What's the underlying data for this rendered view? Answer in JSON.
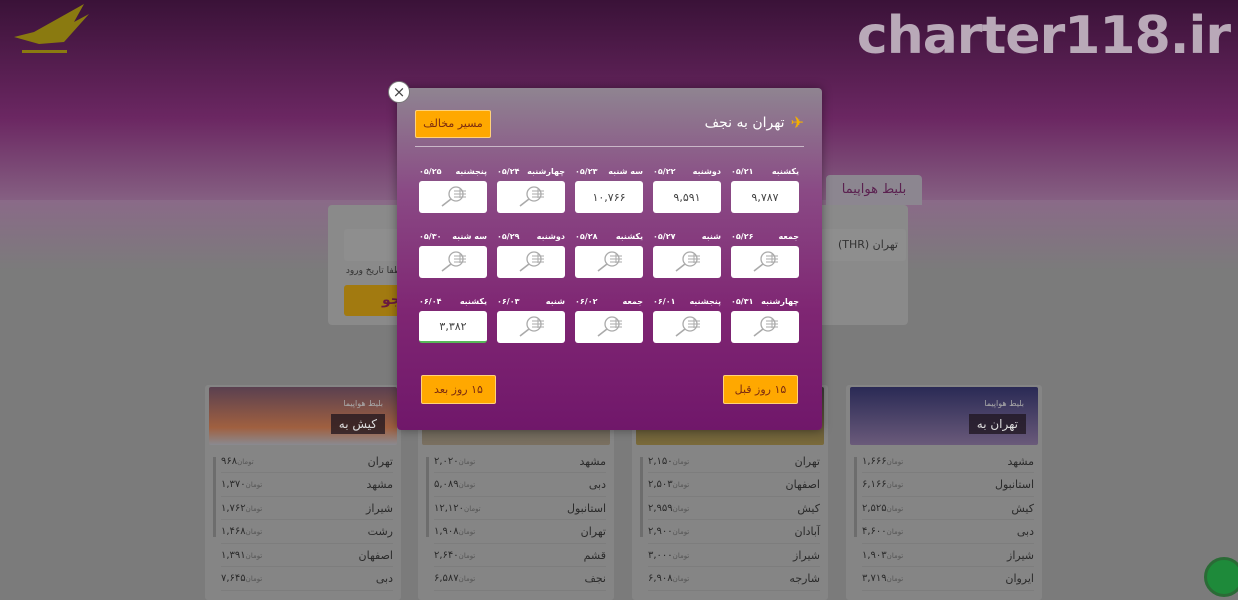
{
  "site": {
    "brand": "charter118.ir",
    "logo_text": "logo"
  },
  "search": {
    "tab_label": "بلیط هواپیما",
    "origin_value": "تهران (THR)",
    "date_hint": "لطفا تاریخ ورود را وارد نمایید",
    "search_button": "جستجو"
  },
  "modal": {
    "title": "تهران به نجف",
    "opposite_route_button": "مسیر مخالف",
    "prev_button": "۱۵ روز قبل",
    "next_button": "۱۵ روز بعد",
    "close_label": "×",
    "days": [
      {
        "weekday": "یکشنبه",
        "date": "۰۵/۲۱",
        "price": "۹,۷۸۷"
      },
      {
        "weekday": "دوشنبه",
        "date": "۰۵/۲۲",
        "price": "۹,۵۹۱"
      },
      {
        "weekday": "سه شنبه",
        "date": "۰۵/۲۳",
        "price": "۱۰,۷۶۶"
      },
      {
        "weekday": "چهارشنبه",
        "date": "۰۵/۲۴",
        "price": null
      },
      {
        "weekday": "پنجشنبه",
        "date": "۰۵/۲۵",
        "price": null
      },
      {
        "weekday": "جمعه",
        "date": "۰۵/۲۶",
        "price": null
      },
      {
        "weekday": "شنبه",
        "date": "۰۵/۲۷",
        "price": null
      },
      {
        "weekday": "یکشنبه",
        "date": "۰۵/۲۸",
        "price": null
      },
      {
        "weekday": "دوشنبه",
        "date": "۰۵/۲۹",
        "price": null
      },
      {
        "weekday": "سه شنبه",
        "date": "۰۵/۳۰",
        "price": null
      },
      {
        "weekday": "چهارشنبه",
        "date": "۰۵/۳۱",
        "price": null
      },
      {
        "weekday": "پنجشنبه",
        "date": "۰۶/۰۱",
        "price": null
      },
      {
        "weekday": "جمعه",
        "date": "۰۶/۰۲",
        "price": null
      },
      {
        "weekday": "شنبه",
        "date": "۰۶/۰۳",
        "price": null
      },
      {
        "weekday": "یکشنبه",
        "date": "۰۶/۰۴",
        "price": "۳,۳۸۲",
        "selected": true
      }
    ]
  },
  "cards": [
    {
      "subtitle": "بلیط هواپیما",
      "title": "تهران به",
      "rows": [
        [
          "مشهد",
          "۱,۶۶۶"
        ],
        [
          "استانبول",
          "۶,۱۶۶"
        ],
        [
          "کیش",
          "۲,۵۲۵"
        ],
        [
          "دبی",
          "۴,۶۰۰"
        ],
        [
          "شیراز",
          "۱,۹۰۳"
        ],
        [
          "ایروان",
          "۳,۷۱۹"
        ]
      ]
    },
    {
      "subtitle": "",
      "title": "",
      "rows": [
        [
          "تهران",
          "۲,۱۵۰"
        ],
        [
          "اصفهان",
          "۲,۵۰۳"
        ],
        [
          "کیش",
          "۲,۹۵۹"
        ],
        [
          "آبادان",
          "۲,۹۰۰"
        ],
        [
          "شیراز",
          "۳,۰۰۰"
        ],
        [
          "شارجه",
          "۶,۹۰۸"
        ]
      ]
    },
    {
      "subtitle": "",
      "title": "",
      "rows": [
        [
          "مشهد",
          "۲,۰۲۰"
        ],
        [
          "دبی",
          "۵,۰۸۹"
        ],
        [
          "استانبول",
          "۱۲,۱۲۰"
        ],
        [
          "تهران",
          "۱,۹۰۸"
        ],
        [
          "قشم",
          "۲,۶۴۰"
        ],
        [
          "نجف",
          "۶,۵۸۷"
        ]
      ]
    },
    {
      "subtitle": "بلیط هواپیما",
      "title": "کیش به",
      "rows": [
        [
          "تهران",
          "۹۶۸"
        ],
        [
          "مشهد",
          "۱,۳۷۰"
        ],
        [
          "شیراز",
          "۱,۷۶۲"
        ],
        [
          "رشت",
          "۱,۴۶۸"
        ],
        [
          "اصفهان",
          "۱,۳۹۱"
        ],
        [
          "دبی",
          "۷,۶۴۵"
        ]
      ]
    }
  ],
  "currency": "تومان",
  "colors": {
    "accent": "#ffa800",
    "modal_purple": "#7f2673",
    "selected_underline": "#58b85a"
  }
}
